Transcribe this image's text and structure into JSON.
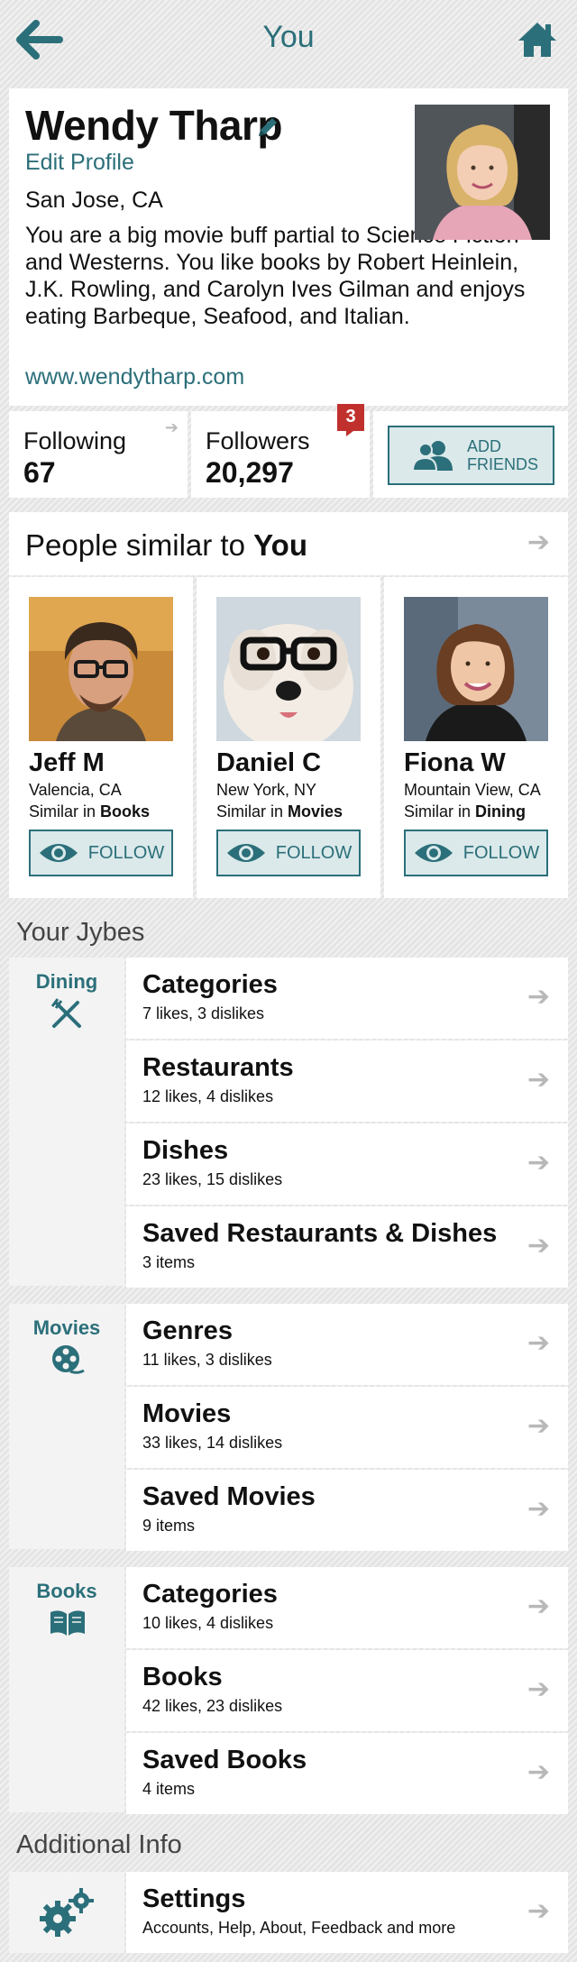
{
  "header": {
    "title": "You",
    "back_icon": "back-arrow-icon",
    "home_icon": "home-icon",
    "accent_color": "#2b6f7a"
  },
  "profile": {
    "name": "Wendy Tharp",
    "edit_label": "Edit Profile",
    "location": "San Jose, CA",
    "bio": "You are a big movie buff partial to Science Fiction and Westerns.  You like books by Robert Heinlein, J.K. Rowling, and Carolyn Ives Gilman and enjoys eating Barbeque, Seafood, and Italian.",
    "website": "www.wendytharp.com"
  },
  "stats": {
    "following_label": "Following",
    "following_value": "67",
    "followers_label": "Followers",
    "followers_value": "20,297",
    "followers_badge": "3",
    "add_friends_label": "ADD FRIENDS"
  },
  "similar": {
    "title_prefix": "People similar to ",
    "title_bold": "You",
    "people": [
      {
        "name": "Jeff M",
        "location": "Valencia, CA",
        "similar_prefix": "Similar in ",
        "similar_in": "Books",
        "follow_label": "FOLLOW"
      },
      {
        "name": "Daniel C",
        "location": "New York, NY",
        "similar_prefix": "Similar in ",
        "similar_in": "Movies",
        "follow_label": "FOLLOW"
      },
      {
        "name": "Fiona W",
        "location": "Mountain View, CA",
        "similar_prefix": "Similar in ",
        "similar_in": "Dining",
        "follow_label": "FOLLOW"
      }
    ]
  },
  "jybes": {
    "section_title": "Your Jybes",
    "groups": [
      {
        "title": "Dining",
        "icon": "fork-knife-icon",
        "items": [
          {
            "title": "Categories",
            "subtitle": "7 likes, 3 dislikes"
          },
          {
            "title": "Restaurants",
            "subtitle": "12 likes, 4 dislikes"
          },
          {
            "title": "Dishes",
            "subtitle": "23 likes, 15 dislikes"
          },
          {
            "title": "Saved Restaurants & Dishes",
            "subtitle": "3 items"
          }
        ]
      },
      {
        "title": "Movies",
        "icon": "film-reel-icon",
        "items": [
          {
            "title": "Genres",
            "subtitle": "11 likes, 3 dislikes"
          },
          {
            "title": "Movies",
            "subtitle": "33 likes, 14 dislikes"
          },
          {
            "title": "Saved Movies",
            "subtitle": "9 items"
          }
        ]
      },
      {
        "title": "Books",
        "icon": "open-book-icon",
        "items": [
          {
            "title": "Categories",
            "subtitle": "10 likes, 4 dislikes"
          },
          {
            "title": "Books",
            "subtitle": "42 likes, 23 dislikes"
          },
          {
            "title": "Saved Books",
            "subtitle": "4 items"
          }
        ]
      }
    ]
  },
  "additional": {
    "section_title": "Additional Info",
    "settings_title": "Settings",
    "settings_subtitle": "Accounts, Help, About, Feedback and more",
    "settings_icon": "gears-icon"
  }
}
